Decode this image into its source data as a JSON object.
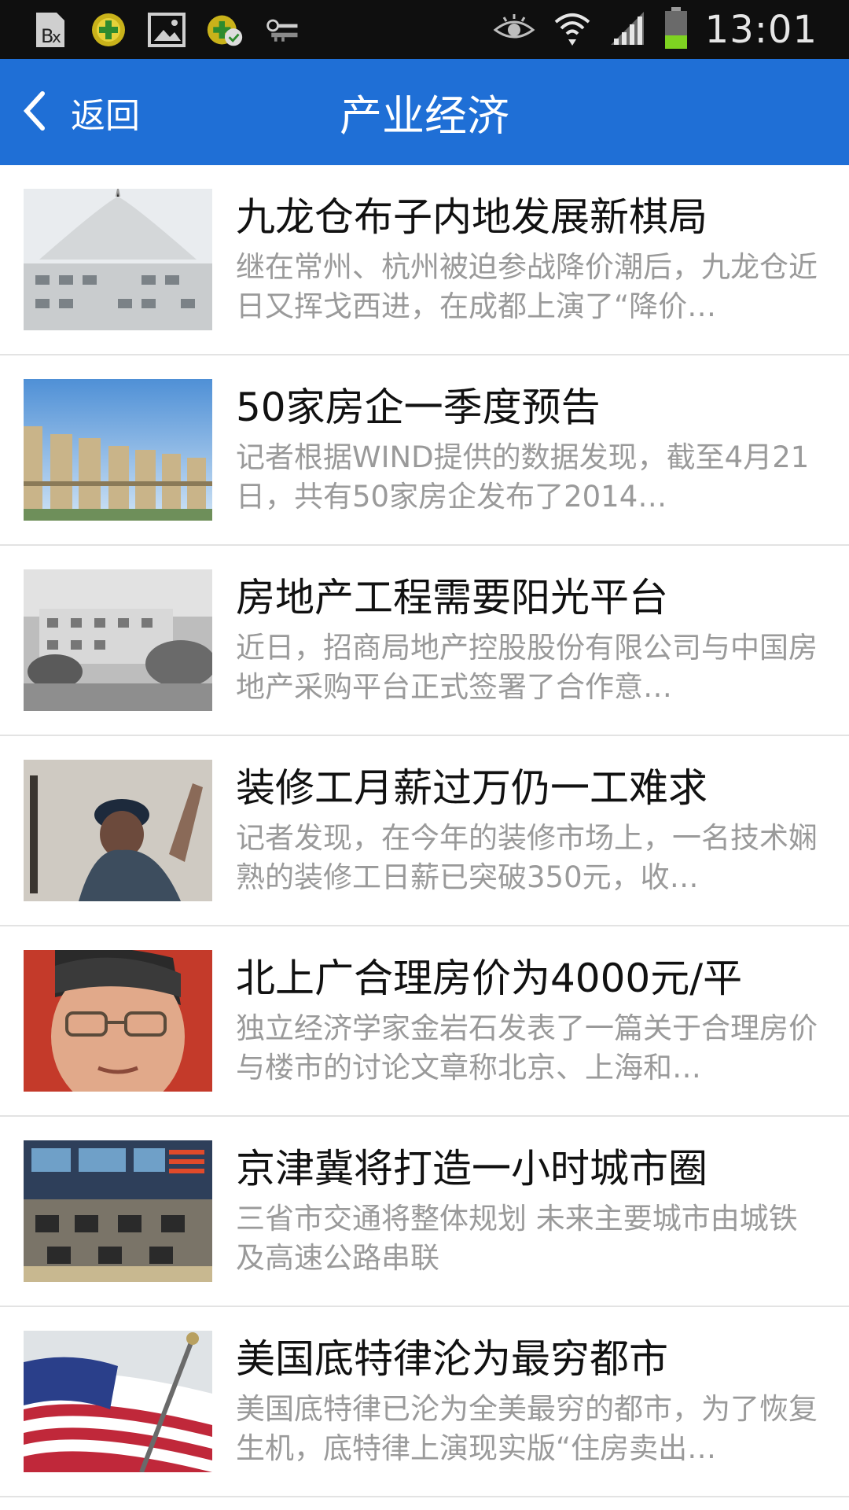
{
  "status_bar": {
    "time": "13:01",
    "left_icons": [
      "sim-icon",
      "plus-app-icon",
      "image-icon",
      "update-icon",
      "keys-icon"
    ],
    "right_icons": [
      "eye-icon",
      "wifi-icon",
      "signal-icon",
      "battery-icon"
    ]
  },
  "header": {
    "back_label": "返回",
    "title": "产业经济",
    "color": "#1f6fd6"
  },
  "articles": [
    {
      "title": "九龙仓布子内地发展新棋局",
      "summary": "继在常州、杭州被迫参战降价潮后，九龙仓近日又挥戈西进，在成都上演了“降价…"
    },
    {
      "title": "50家房企一季度预告",
      "summary": "记者根据WIND提供的数据发现，截至4月21日，共有50家房企发布了2014…"
    },
    {
      "title": "房地产工程需要阳光平台",
      "summary": "近日，招商局地产控股股份有限公司与中国房地产采购平台正式签署了合作意…"
    },
    {
      "title": "装修工月薪过万仍一工难求",
      "summary": "记者发现，在今年的装修市场上，一名技术娴熟的装修工日薪已突破350元，收…"
    },
    {
      "title": "北上广合理房价为4000元/平",
      "summary": "独立经济学家金岩石发表了一篇关于合理房价与楼市的讨论文章称北京、上海和…"
    },
    {
      "title": "京津冀将打造一小时城市圈",
      "summary": "三省市交通将整体规划 未来主要城市由城铁及高速公路串联"
    },
    {
      "title": "美国底特律沦为最穷都市",
      "summary": "美国底特律已沦为全美最穷的都市，为了恢复生机，底特律上演现实版“住房卖出…"
    }
  ]
}
